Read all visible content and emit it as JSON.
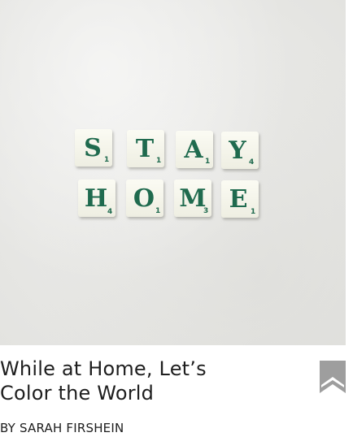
{
  "hero_image": {
    "tiles_row1": [
      {
        "letter": "S",
        "score": "1"
      },
      {
        "letter": "T",
        "score": "1"
      },
      {
        "letter": "A",
        "score": "1"
      },
      {
        "letter": "Y",
        "score": "4"
      }
    ],
    "tiles_row2": [
      {
        "letter": "H",
        "score": "4"
      },
      {
        "letter": "O",
        "score": "1"
      },
      {
        "letter": "M",
        "score": "3"
      },
      {
        "letter": "E",
        "score": "1"
      }
    ]
  },
  "article": {
    "title_line1": "While at Home, Let’s",
    "title_line2": "Color the World",
    "byline_prefix": "BY",
    "author": "SARAH FIRSHEIN"
  },
  "colors": {
    "tile_text": "#1f6a4e",
    "bookmark": "#9e9e9e",
    "text": "#1e1e1e"
  },
  "icons": {
    "bookmark": "bookmark-icon"
  }
}
